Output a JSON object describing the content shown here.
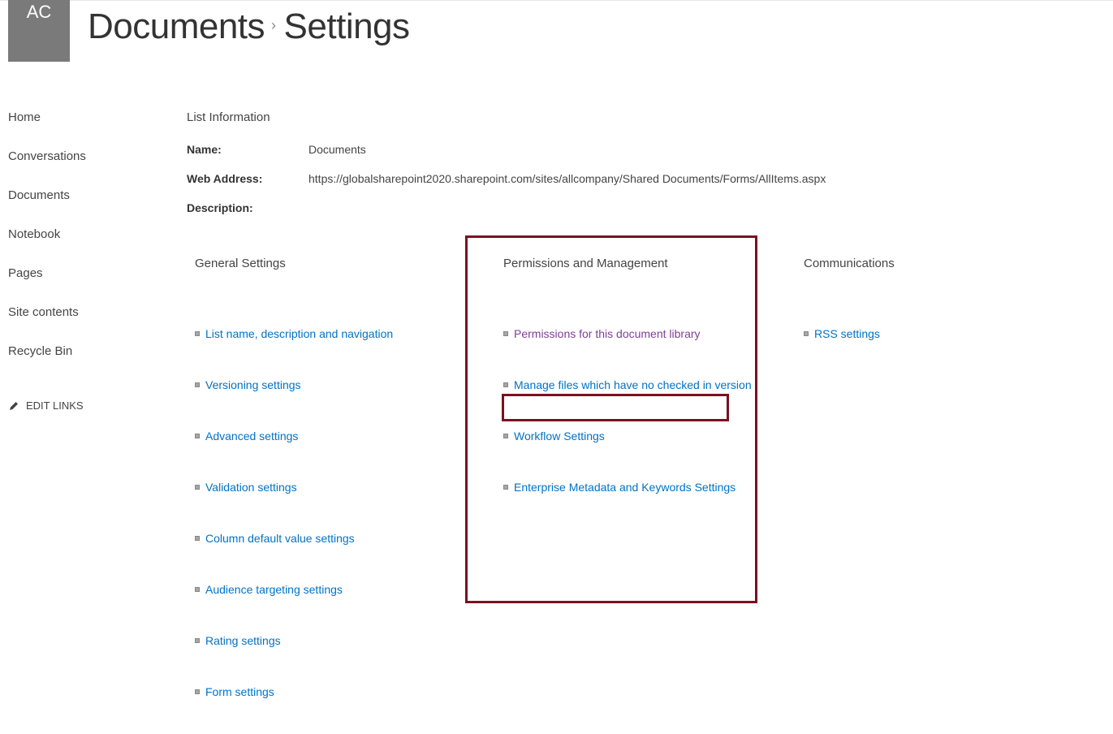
{
  "header": {
    "logo_text": "AC",
    "title": "Documents",
    "separator": "›",
    "subtitle": "Settings"
  },
  "left_nav": {
    "items": [
      {
        "label": "Home"
      },
      {
        "label": "Conversations"
      },
      {
        "label": "Documents"
      },
      {
        "label": "Notebook"
      },
      {
        "label": "Pages"
      },
      {
        "label": "Site contents"
      },
      {
        "label": "Recycle Bin"
      }
    ],
    "edit_links_label": "EDIT LINKS",
    "edit_links_icon": "pencil-icon"
  },
  "list_info": {
    "title": "List Information",
    "name_label": "Name:",
    "name_value": "Documents",
    "web_address_label": "Web Address:",
    "web_address_value": "https://globalsharepoint2020.sharepoint.com/sites/allcompany/Shared Documents/Forms/AllItems.aspx",
    "description_label": "Description:",
    "description_value": ""
  },
  "sections": {
    "general": {
      "heading": "General Settings",
      "links": [
        {
          "label": "List name, description and navigation"
        },
        {
          "label": "Versioning settings"
        },
        {
          "label": "Advanced settings"
        },
        {
          "label": "Validation settings"
        },
        {
          "label": "Column default value settings"
        },
        {
          "label": "Audience targeting settings"
        },
        {
          "label": "Rating settings"
        },
        {
          "label": "Form settings"
        }
      ]
    },
    "permissions": {
      "heading": "Permissions and Management",
      "links": [
        {
          "label": "Permissions for this document library"
        },
        {
          "label": "Manage files which have no checked in version"
        },
        {
          "label": "Workflow Settings"
        },
        {
          "label": "Enterprise Metadata and Keywords Settings"
        }
      ]
    },
    "communications": {
      "heading": "Communications",
      "links": [
        {
          "label": "RSS settings"
        }
      ]
    }
  },
  "colors": {
    "link": "#0072c6",
    "visited_link": "#7f3f98",
    "highlight_border": "#7b1020",
    "logo_background": "#7a7a7a"
  }
}
